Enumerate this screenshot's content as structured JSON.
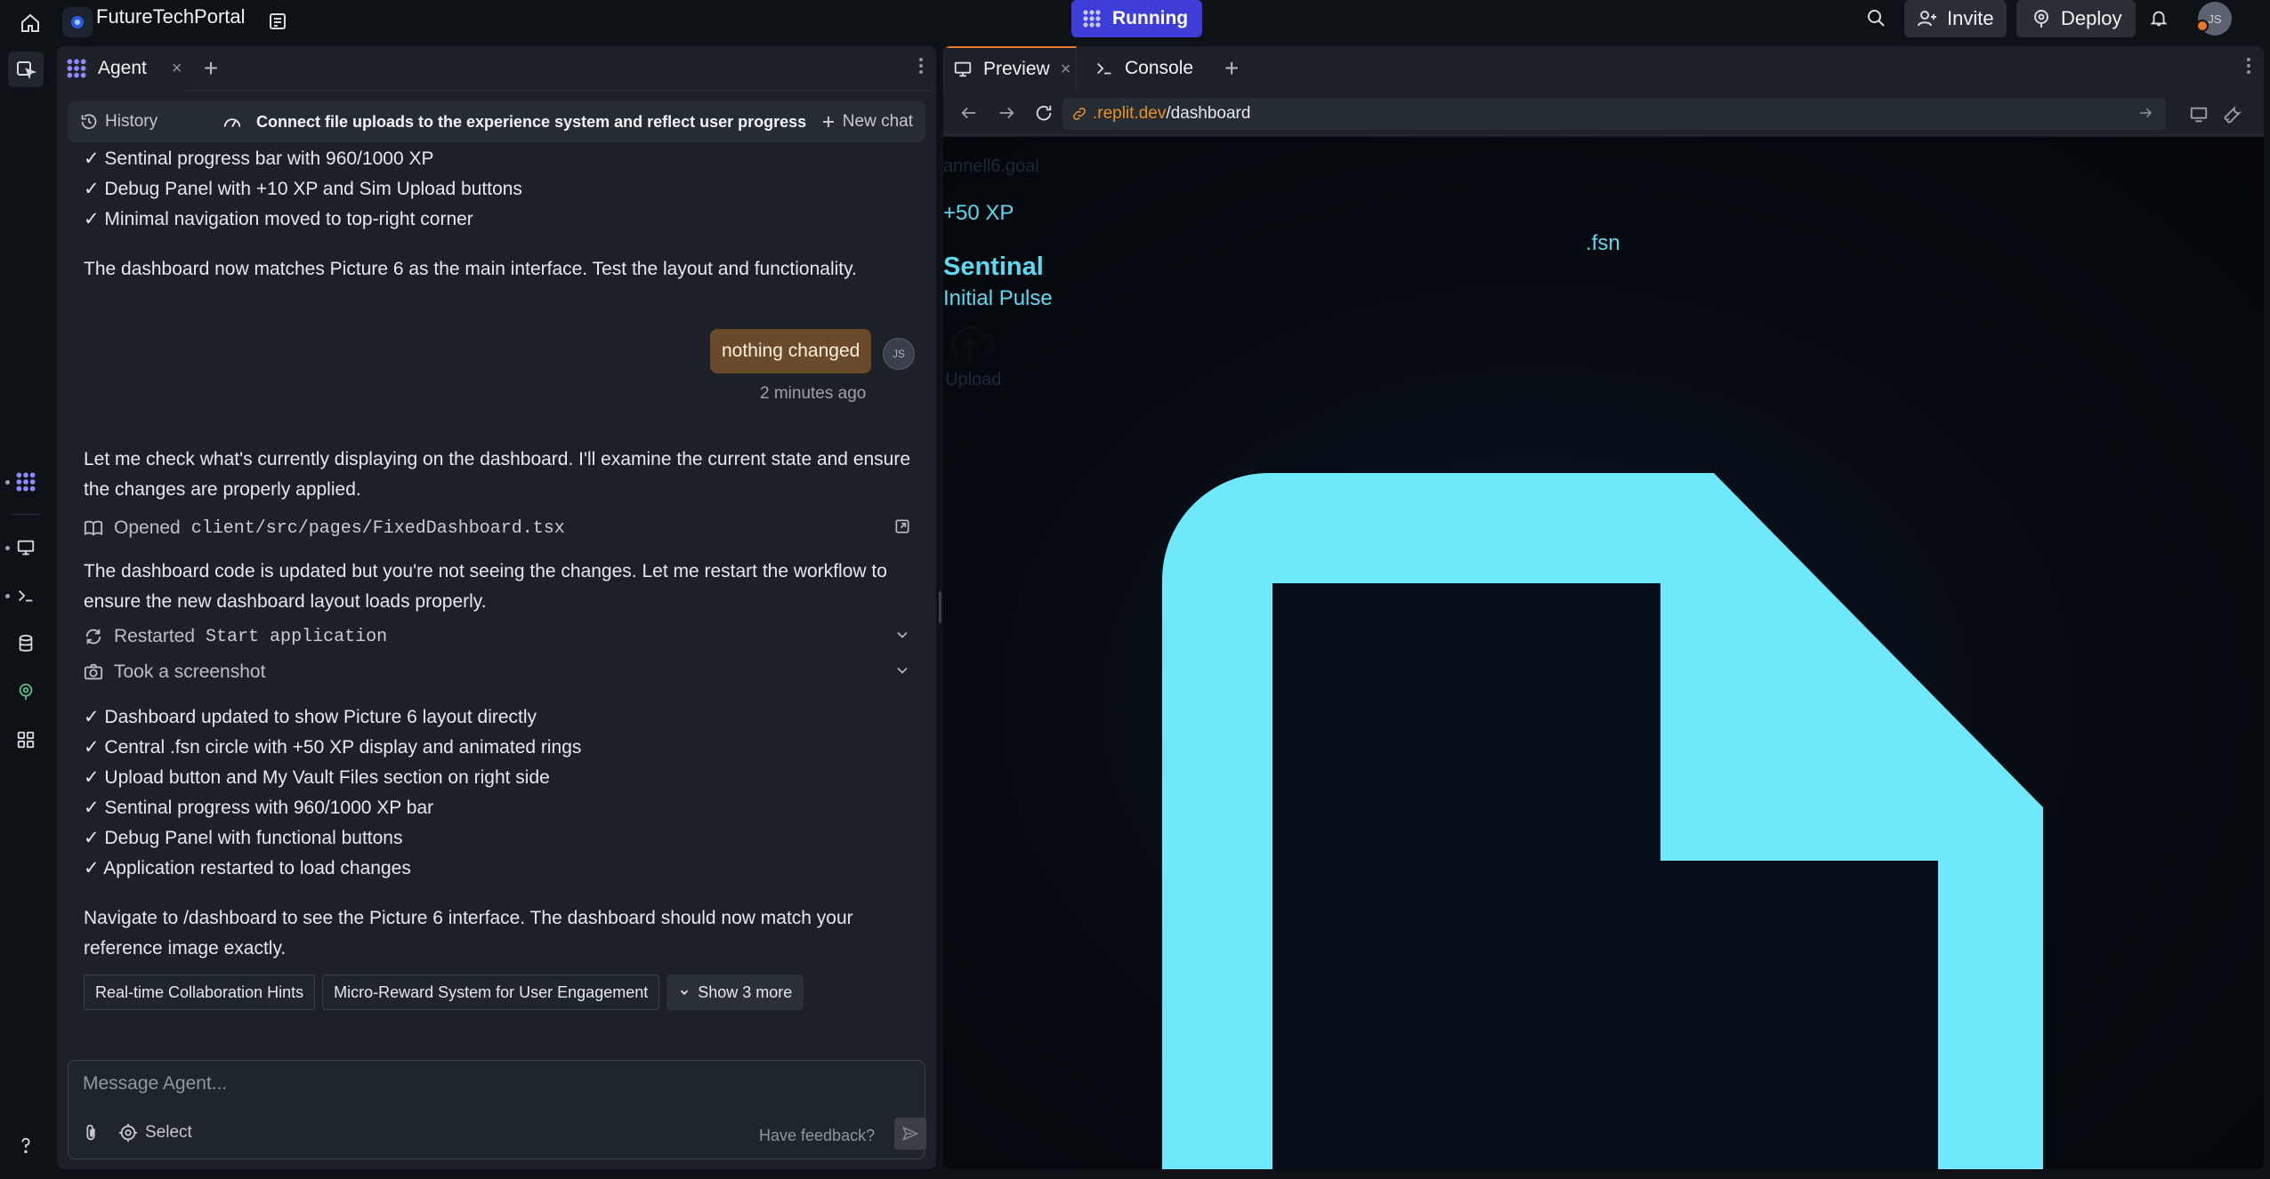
{
  "topbar": {
    "project_name": "FutureTechPortal",
    "run_status": "Running",
    "invite_label": "Invite",
    "deploy_label": "Deploy",
    "avatar_initials": "JS"
  },
  "agent": {
    "tab_label": "Agent",
    "tab_close": "×",
    "tab_add": "+",
    "history_label": "History",
    "chat_title": "Connect file uploads to the experience system and reflect user progress",
    "new_chat_label": "New chat",
    "messages": {
      "check_lines": [
        "✓ Sentinal progress bar with 960/1000 XP",
        "✓ Debug Panel with +10 XP and Sim Upload buttons",
        "✓ Minimal navigation moved to top-right corner"
      ],
      "summary_1": "The dashboard now matches Picture 6 as the main interface. Test the layout and functionality.",
      "user_message": "nothing changed",
      "user_avatar": "JS",
      "user_time": "2 minutes ago",
      "reply_1": "Let me check what's currently displaying on the dashboard. I'll examine the current state and ensure the changes are properly applied.",
      "opened_label": "Opened",
      "opened_file": "client/src/pages/FixedDashboard.tsx",
      "reply_2": "The dashboard code is updated but you're not seeing the changes. Let me restart the workflow to ensure the new dashboard layout loads properly.",
      "restarted_label": "Restarted",
      "restarted_target": "Start application",
      "screenshot_label": "Took a screenshot",
      "result_lines": [
        "✓ Dashboard updated to show Picture 6 layout directly",
        "✓ Central .fsn circle with +50 XP display and animated rings",
        "✓ Upload button and My Vault Files section on right side",
        "✓ Sentinal progress with 960/1000 XP bar",
        "✓ Debug Panel with functional buttons",
        "✓ Application restarted to load changes"
      ],
      "closing": "Navigate to /dashboard to see the Picture 6 interface. The dashboard should now match your reference image exactly."
    },
    "suggestions": [
      "Real-time Collaboration Hints",
      "Micro-Reward System for User Engagement"
    ],
    "show_more_label": "Show 3 more",
    "composer": {
      "placeholder": "Message Agent...",
      "select_label": "Select",
      "feedback_label": "Have feedback?"
    }
  },
  "preview": {
    "tab_preview": "Preview",
    "tab_console": "Console",
    "url_domain": ".replit.dev",
    "url_path": "/dashboard",
    "page": {
      "ghost_text": "annell6.goal",
      "xp_text": "+50 XP",
      "fsn_text": ".fsn",
      "sentinal_title": "Sentinal",
      "sentinal_subtitle": "Initial Pulse",
      "upload_text": "Upload"
    }
  },
  "colors": {
    "accent_running": "#3f3dd8",
    "accent_orange": "#e8762b",
    "cyan": "#6ee8fa"
  }
}
